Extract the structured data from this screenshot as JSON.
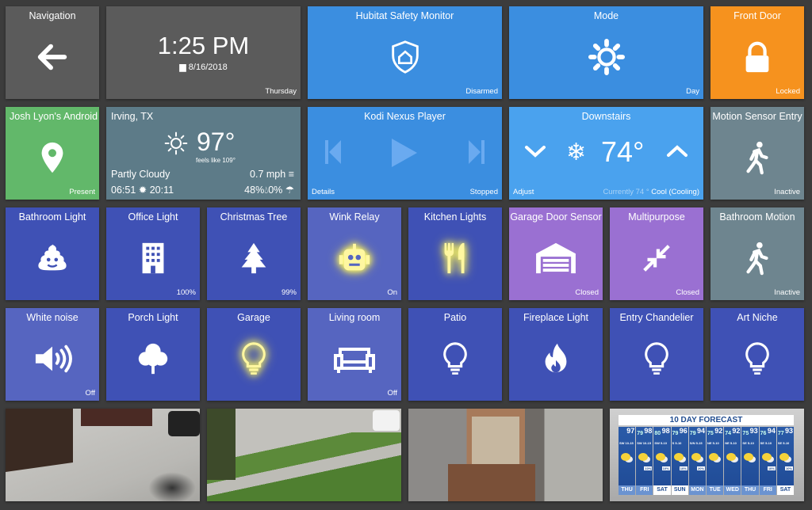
{
  "navigation": {
    "title": "Navigation",
    "icon": "arrow-left-icon"
  },
  "clock": {
    "time": "1:25 PM",
    "date": "8/16/2018",
    "day": "Thursday"
  },
  "hsm": {
    "title": "Hubitat Safety Monitor",
    "status": "Disarmed",
    "icon": "shield-home-icon"
  },
  "mode": {
    "title": "Mode",
    "status": "Day",
    "icon": "sun-icon"
  },
  "front_door": {
    "title": "Front Door",
    "status": "Locked",
    "icon": "lock-icon"
  },
  "presence": {
    "title": "Josh Lyon's Android",
    "status": "Present",
    "icon": "map-marker-icon"
  },
  "weather": {
    "location": "Irving, TX",
    "temp": "97°",
    "feels_like": "feels like 109°",
    "condition": "Partly Cloudy",
    "wind": "0.7 mph",
    "sunrise": "06:51",
    "sunset": "20:11",
    "humidity": "48%",
    "precip": "0%"
  },
  "kodi": {
    "title": "Kodi Nexus Player",
    "left": "Details",
    "status": "Stopped"
  },
  "thermostat": {
    "title": "Downstairs",
    "setpoint": "74°",
    "left": "Adjust",
    "current": "Currently 74 °",
    "mode": "Cool (Cooling)"
  },
  "motion_entry": {
    "title": "Motion Sensor Entry",
    "status": "Inactive",
    "icon": "walking-person-icon"
  },
  "row3": [
    {
      "title": "Bathroom Light",
      "status": "",
      "icon": "poop-icon"
    },
    {
      "title": "Office Light",
      "status": "100%",
      "icon": "building-icon"
    },
    {
      "title": "Christmas Tree",
      "status": "99%",
      "icon": "tree-icon"
    },
    {
      "title": "Wink Relay",
      "status": "On",
      "icon": "robot-icon"
    },
    {
      "title": "Kitchen Lights",
      "status": "",
      "icon": "utensils-icon"
    },
    {
      "title": "Garage Door Sensor",
      "status": "Closed",
      "icon": "garage-icon"
    },
    {
      "title": "Multipurpose",
      "status": "Closed",
      "icon": "arrows-in-icon"
    },
    {
      "title": "Bathroom Motion",
      "status": "Inactive",
      "icon": "walking-person-icon"
    }
  ],
  "row4": [
    {
      "title": "White noise",
      "status": "Off",
      "icon": "speaker-icon"
    },
    {
      "title": "Porch Light",
      "status": "",
      "icon": "tree-round-icon"
    },
    {
      "title": "Garage",
      "status": "",
      "icon": "bulb-icon"
    },
    {
      "title": "Living room",
      "status": "Off",
      "icon": "sofa-icon"
    },
    {
      "title": "Patio",
      "status": "",
      "icon": "bulb-icon"
    },
    {
      "title": "Fireplace Light",
      "status": "",
      "icon": "flame-icon"
    },
    {
      "title": "Entry Chandelier",
      "status": "",
      "icon": "bulb-icon"
    },
    {
      "title": "Art Niche",
      "status": "",
      "icon": "bulb-icon"
    }
  ],
  "forecast": {
    "title": "10 DAY FORECAST",
    "days": [
      {
        "d": "THU",
        "hi": "97",
        "lo": "",
        "wind": "SW 10-15",
        "rain": ""
      },
      {
        "d": "FRI",
        "hi": "98",
        "lo": "79",
        "wind": "SW 10-15",
        "rain": "10%"
      },
      {
        "d": "SAT",
        "hi": "98",
        "lo": "80",
        "wind": "SW 5-10",
        "rain": "10%"
      },
      {
        "d": "SUN",
        "hi": "96",
        "lo": "79",
        "wind": "S 5-10",
        "rain": "10%"
      },
      {
        "d": "MON",
        "hi": "94",
        "lo": "79",
        "wind": "S/N 5-15",
        "rain": "20%"
      },
      {
        "d": "TUE",
        "hi": "92",
        "lo": "75",
        "wind": "NE 5-10",
        "rain": ""
      },
      {
        "d": "WED",
        "hi": "92",
        "lo": "74",
        "wind": "NE 5-10",
        "rain": ""
      },
      {
        "d": "THU",
        "hi": "93",
        "lo": "75",
        "wind": "SE 5-10",
        "rain": ""
      },
      {
        "d": "FRI",
        "hi": "94",
        "lo": "76",
        "wind": "SE 5-10",
        "rain": "10%"
      },
      {
        "d": "SAT",
        "hi": "93",
        "lo": "77",
        "wind": "SE 5-10",
        "rain": "10%"
      }
    ]
  }
}
